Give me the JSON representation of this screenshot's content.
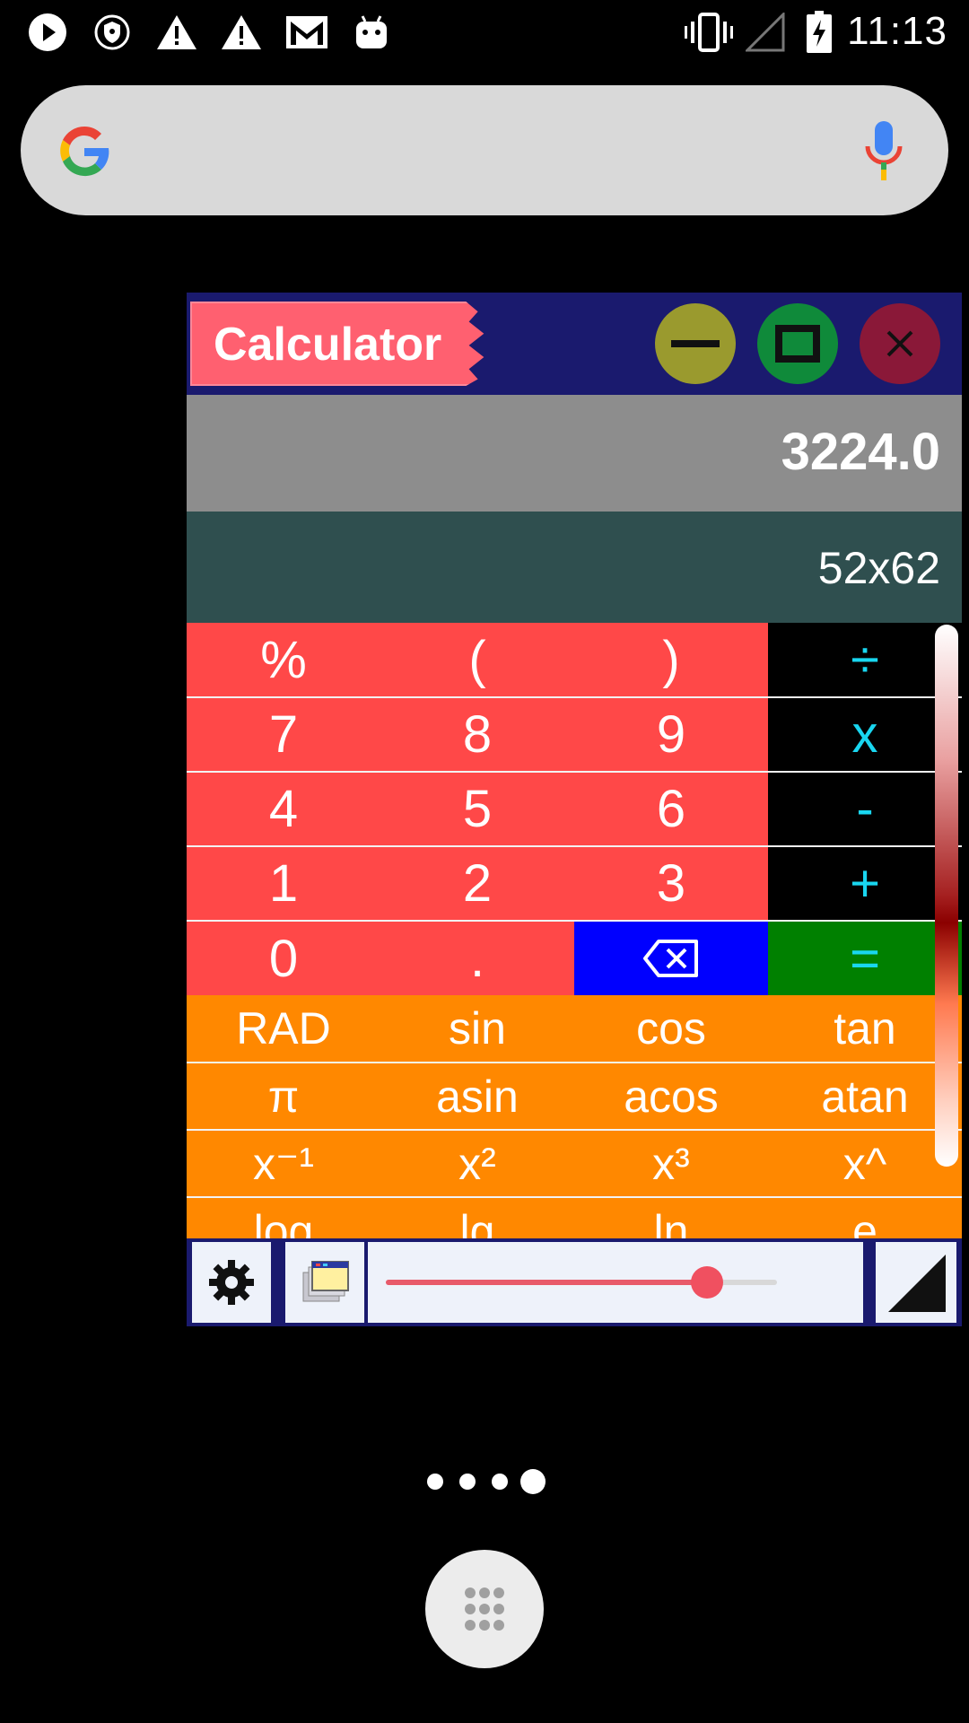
{
  "status_bar": {
    "time": "11:13",
    "icons": [
      "play-icon",
      "shield-icon",
      "warning-icon",
      "warning-icon",
      "gmail-icon",
      "android-icon",
      "vibrate-icon",
      "signal-icon",
      "battery-charging-icon"
    ]
  },
  "search": {
    "logo": "google-g-icon",
    "mic": "mic-icon"
  },
  "calculator": {
    "title": "Calculator",
    "result": "3224.0",
    "expression": "52x62",
    "rows": [
      [
        "%",
        "(",
        ")",
        "÷"
      ],
      [
        "7",
        "8",
        "9",
        "x"
      ],
      [
        "4",
        "5",
        "6",
        "-"
      ],
      [
        "1",
        "2",
        "3",
        "+"
      ],
      [
        "0",
        ".",
        "⌫",
        "="
      ],
      [
        "RAD",
        "sin",
        "cos",
        "tan"
      ],
      [
        "π",
        "asin",
        "acos",
        "atan"
      ],
      [
        "x⁻¹",
        "x²",
        "x³",
        "x^"
      ],
      [
        "log",
        "lg",
        "ln",
        "e"
      ]
    ],
    "opacity_slider_fraction": 0.82
  },
  "home": {
    "page_dots": 4,
    "active_page": 4
  },
  "colors": {
    "number_key": "#ff4848",
    "operator_key": "#000000",
    "operator_text": "#19d6f0",
    "backspace_key": "#0000ff",
    "equals_key": "#008000",
    "scientific_key": "#ff8800",
    "title_bar": "#1a1a6e"
  }
}
